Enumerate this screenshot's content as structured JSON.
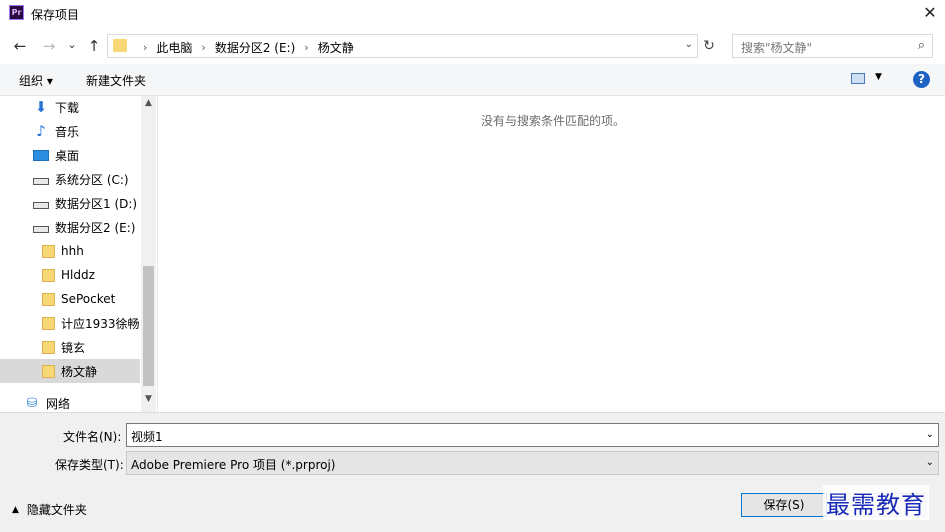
{
  "window": {
    "title": "保存项目",
    "app_icon_text": "Pr",
    "close_glyph": "✕"
  },
  "nav": {
    "back_glyph": "←",
    "forward_glyph": "→",
    "recent_glyph": "⌄",
    "up_glyph": "↑",
    "breadcrumbs": [
      "此电脑",
      "数据分区2 (E:)",
      "杨文静"
    ],
    "separator": "›",
    "dropdown_glyph": "⌄",
    "refresh_glyph": "↻",
    "search_placeholder": "搜索\"杨文静\""
  },
  "toolbar": {
    "organize_label": "组织 ▾",
    "new_folder_label": "新建文件夹",
    "view_drop": "▼",
    "help_glyph": "?"
  },
  "sidebar": {
    "items": [
      {
        "label": "下载",
        "icon": "download-icon"
      },
      {
        "label": "音乐",
        "icon": "music-icon"
      },
      {
        "label": "桌面",
        "icon": "desktop-icon"
      },
      {
        "label": "系统分区 (C:)",
        "icon": "drive-icon"
      },
      {
        "label": "数据分区1 (D:)",
        "icon": "drive-icon"
      },
      {
        "label": "数据分区2 (E:)",
        "icon": "drive-icon"
      },
      {
        "label": "hhh",
        "icon": "folder-icon"
      },
      {
        "label": "Hlddz",
        "icon": "folder-icon"
      },
      {
        "label": "SePocket",
        "icon": "folder-icon"
      },
      {
        "label": "计应1933徐畅",
        "icon": "folder-icon"
      },
      {
        "label": "镜玄",
        "icon": "folder-icon"
      },
      {
        "label": "杨文静",
        "icon": "folder-icon",
        "selected": true
      },
      {
        "label": "网络",
        "icon": "network-icon"
      }
    ],
    "scroll_up": "▲",
    "scroll_down": "▼"
  },
  "content": {
    "empty_message": "没有与搜索条件匹配的项。"
  },
  "form": {
    "filename_label": "文件名(N):",
    "filename_value": "视频1",
    "filetype_label": "保存类型(T):",
    "filetype_value": "Adobe Premiere Pro 项目 (*.prproj)",
    "dropdown_glyph": "⌄"
  },
  "footer": {
    "hide_folders_label": "隐藏文件夹",
    "hide_chevron": "▲",
    "save_label": "保存(S)",
    "watermark": "最需教育"
  }
}
